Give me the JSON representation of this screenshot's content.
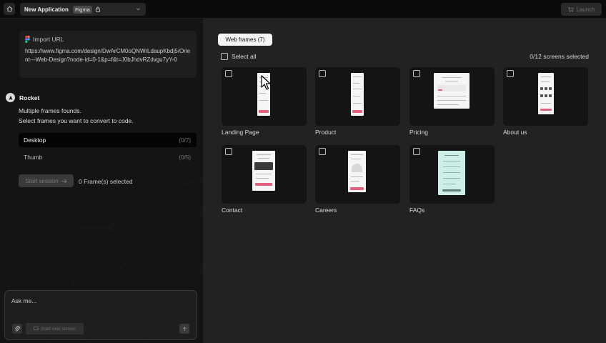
{
  "topbar": {
    "app_name": "New Application",
    "badge": "Figma",
    "launch_label": "Launch"
  },
  "left": {
    "import_label": "Import URL",
    "url": "https://www.figma.com/design/DwArCM0oQNWrLdaupKbdj5/Orient---Web-Design?node-id=0-1&p=f&t=J0bJhdvRZdvgu7yY-0",
    "agent_name": "Rocket",
    "message_line1": "Multiple frames founds.",
    "message_line2": "Select frames you want to convert to code.",
    "frames": [
      {
        "label": "Desktop",
        "count": "(0/7)",
        "active": true
      },
      {
        "label": "Thumb",
        "count": "(0/5)",
        "active": false
      }
    ],
    "start_label": "Start session",
    "selected_count": "0 Frame(s) selected",
    "ask_placeholder": "Ask me...",
    "screen_button_label": "Start new screen"
  },
  "right": {
    "tab_label": "Web frames (7)",
    "select_all": "Select all",
    "screens_selected": "0/12 screens selected",
    "cards": [
      {
        "label": "Landing Page"
      },
      {
        "label": "Product"
      },
      {
        "label": "Pricing"
      },
      {
        "label": "About us"
      },
      {
        "label": "Contact"
      },
      {
        "label": "Careers"
      },
      {
        "label": "FAQs"
      }
    ]
  },
  "colors": {
    "background": "#111111",
    "panel_left": "#141414",
    "panel_right": "#222222",
    "accent_pink": "#e0607e",
    "accent_mint": "#cdeee6"
  },
  "icons": [
    "home-icon",
    "lock-icon",
    "chevron-down-icon",
    "cart-icon",
    "figma-icon",
    "rocket-icon",
    "arrow-right-icon",
    "paperclip-icon",
    "screen-icon",
    "send-icon",
    "cursor-icon"
  ]
}
